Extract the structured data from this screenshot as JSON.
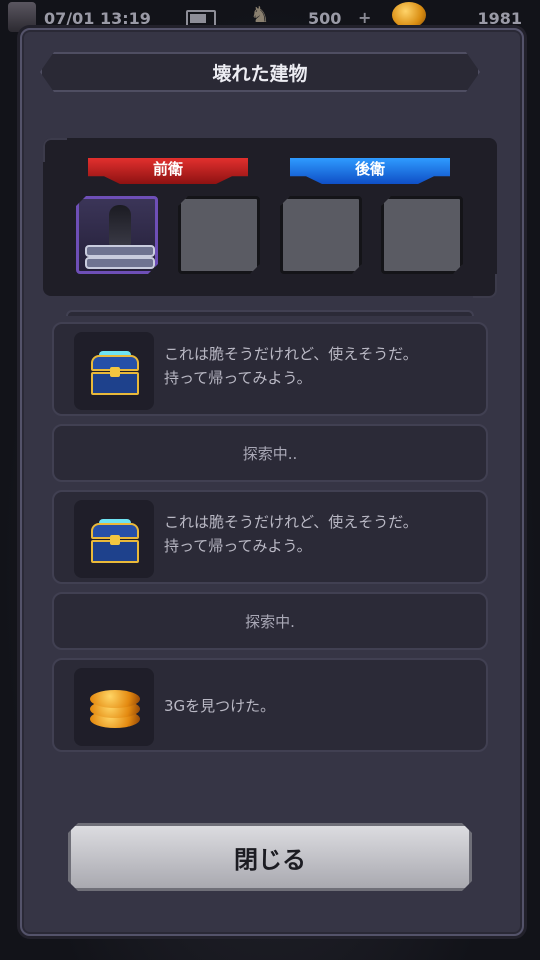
{
  "status_bar": {
    "time": "07/01 13:19",
    "gold": "500",
    "plus": "+",
    "gems": "1981"
  },
  "dialog": {
    "title": "壊れた建物",
    "party": {
      "front_label": "前衛",
      "back_label": "後衛"
    },
    "log": [
      {
        "type": "item",
        "icon": "treasure-chest-icon",
        "text_line1": "これは脆そうだけれど、使えそうだ。",
        "text_line2": "持って帰ってみよう。"
      },
      {
        "type": "status",
        "text": "探索中.."
      },
      {
        "type": "item",
        "icon": "treasure-chest-icon",
        "text_line1": "これは脆そうだけれど、使えそうだ。",
        "text_line2": "持って帰ってみよう。"
      },
      {
        "type": "status",
        "text": "探索中."
      },
      {
        "type": "item",
        "icon": "gold-coins-icon",
        "text_line1": "3Gを見つけた。",
        "text_line2": ""
      }
    ],
    "close_label": "閉じる"
  }
}
